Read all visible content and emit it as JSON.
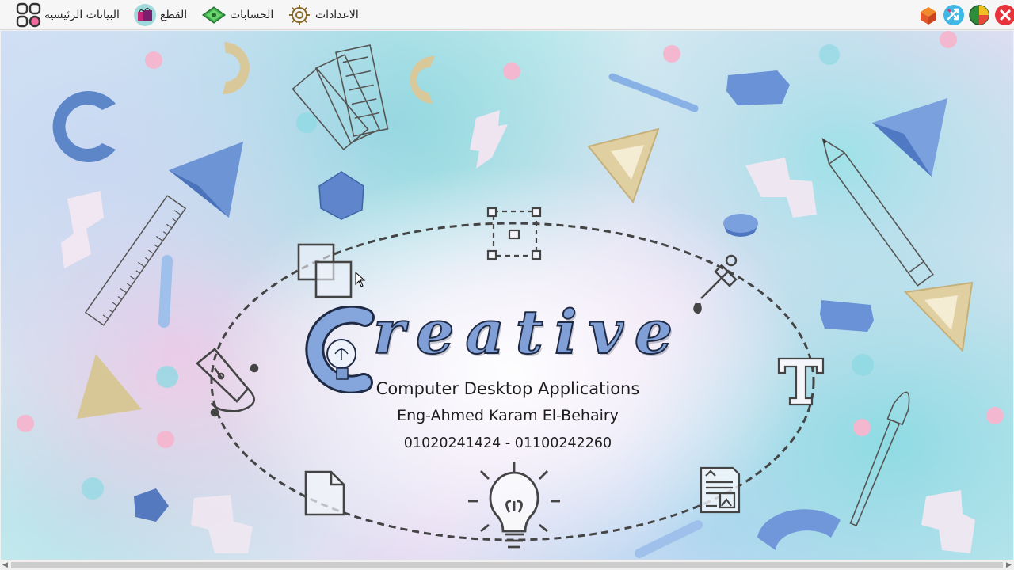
{
  "menu": {
    "home_label": "البيانات الرئيسية",
    "parts_label": "القطع",
    "accounts_label": "الحسابات",
    "settings_label": "الاعدادات"
  },
  "splash": {
    "logo_word": "Creative",
    "line1": "Computer Desktop Applications",
    "line2": "Eng-Ahmed Karam El-Behairy",
    "line3": "01020241424 - 01100242260"
  },
  "colors": {
    "close_button": "#e8323c",
    "accent_blue": "#7f9fd6",
    "menubar_bg": "#f6f6f6"
  },
  "icons": [
    "grid-apps-icon",
    "shopping-bags-icon",
    "money-icon",
    "gear-icon",
    "office-icon",
    "shuffle-icon",
    "chart-icon",
    "close-icon"
  ]
}
